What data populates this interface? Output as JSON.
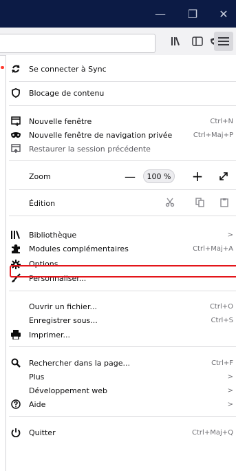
{
  "window": {
    "minimize": "—",
    "restore": "❐",
    "close": "✕"
  },
  "menu": {
    "sync": "Se connecter à Sync",
    "content_blocking": "Blocage de contenu",
    "new_window": {
      "label": "Nouvelle fenêtre",
      "shortcut": "Ctrl+N"
    },
    "new_private": {
      "label": "Nouvelle fenêtre de navigation privée",
      "shortcut": "Ctrl+Maj+P"
    },
    "restore_session": "Restaurer la session précédente",
    "zoom": {
      "label": "Zoom",
      "minus": "—",
      "value": "100 %",
      "plus": "+"
    },
    "edit": "Édition",
    "library": {
      "label": "Bibliothèque",
      "arrow": ">"
    },
    "addons": {
      "label": "Modules complémentaires",
      "shortcut": "Ctrl+Maj+A"
    },
    "options": "Options",
    "customize": "Personnaliser...",
    "open_file": {
      "label": "Ouvrir un fichier...",
      "shortcut": "Ctrl+O"
    },
    "save_as": {
      "label": "Enregistrer sous...",
      "shortcut": "Ctrl+S"
    },
    "print": "Imprimer...",
    "find": {
      "label": "Rechercher dans la page...",
      "shortcut": "Ctrl+F"
    },
    "more": {
      "label": "Plus",
      "arrow": ">"
    },
    "webdev": {
      "label": "Développement web",
      "arrow": ">"
    },
    "help": {
      "label": "Aide",
      "arrow": ">"
    },
    "quit": {
      "label": "Quitter",
      "shortcut": "Ctrl+Maj+Q"
    }
  },
  "colors": {
    "titlebar": "#0c1b45",
    "highlight": "#e3151a"
  }
}
